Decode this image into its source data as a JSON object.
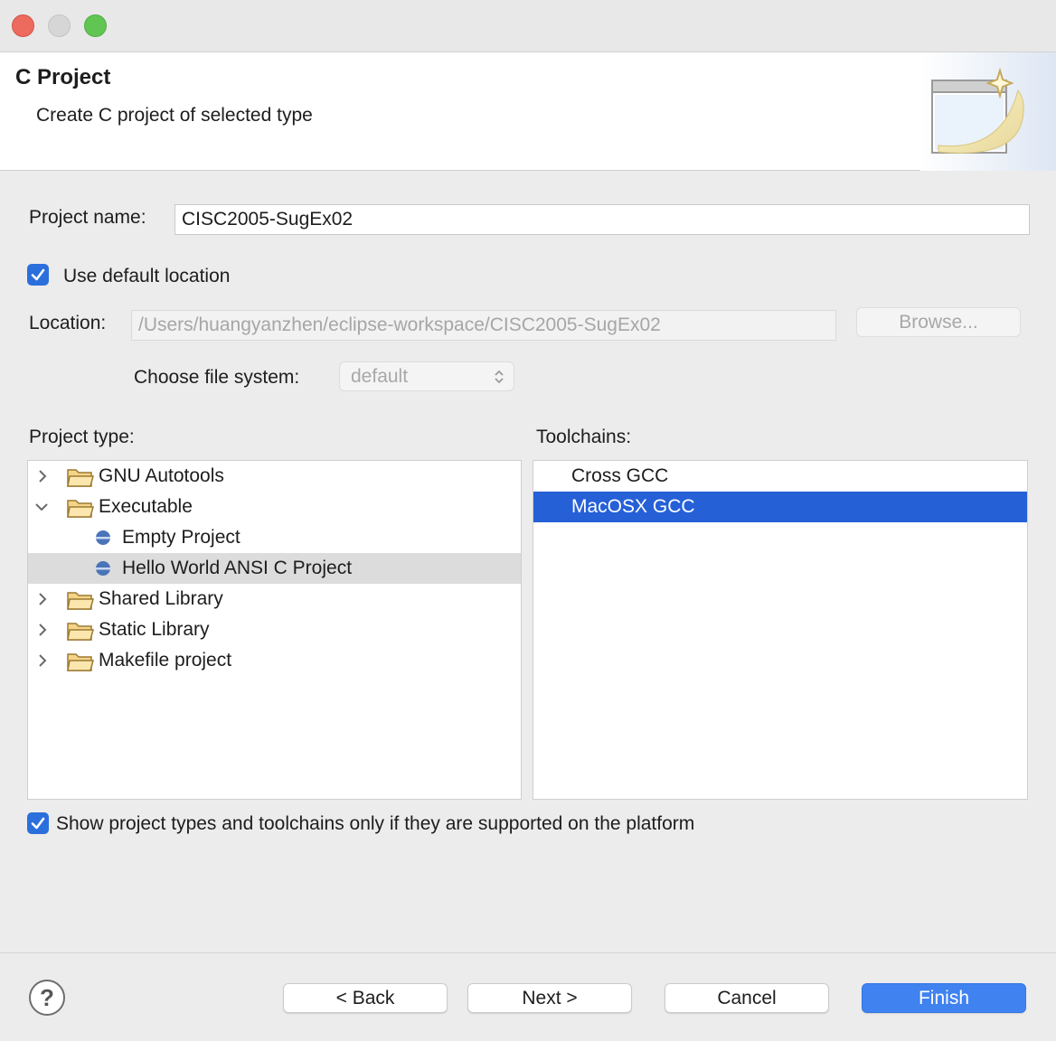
{
  "window": {
    "traffic_lights": [
      "close",
      "minimize",
      "zoom"
    ]
  },
  "header": {
    "title": "C Project",
    "subtitle": "Create C project of selected type"
  },
  "form": {
    "project_name_label": "Project name:",
    "project_name_value": "CISC2005-SugEx02",
    "use_default_location_label": "Use default location",
    "use_default_location_checked": true,
    "location_label": "Location:",
    "location_value": "/Users/huangyanzhen/eclipse-workspace/CISC2005-SugEx02",
    "browse_label": "Browse...",
    "file_system_label": "Choose file system:",
    "file_system_value": "default"
  },
  "project_type": {
    "label": "Project type:",
    "items": [
      {
        "label": "GNU Autotools",
        "expanded": false,
        "icon": "folder-icon"
      },
      {
        "label": "Executable",
        "expanded": true,
        "icon": "folder-icon"
      },
      {
        "label": "Empty Project",
        "icon": "project-template-icon"
      },
      {
        "label": "Hello World ANSI C Project",
        "icon": "project-template-icon",
        "selected": true
      },
      {
        "label": "Shared Library",
        "expanded": false,
        "icon": "folder-icon"
      },
      {
        "label": "Static Library",
        "expanded": false,
        "icon": "folder-icon"
      },
      {
        "label": "Makefile project",
        "expanded": false,
        "icon": "folder-icon"
      }
    ]
  },
  "toolchains": {
    "label": "Toolchains:",
    "items": [
      {
        "label": "Cross GCC"
      },
      {
        "label": "MacOSX GCC",
        "selected": true
      }
    ]
  },
  "platform_filter": {
    "label": "Show project types and toolchains only if they are supported on the platform",
    "checked": true
  },
  "footer": {
    "help_icon": "help-icon",
    "back_label": "< Back",
    "next_label": "Next >",
    "cancel_label": "Cancel",
    "finish_label": "Finish"
  },
  "colors": {
    "accent": "#3f82f0",
    "selection_blue": "#2560d7",
    "selection_gray": "#dcdcdc"
  }
}
